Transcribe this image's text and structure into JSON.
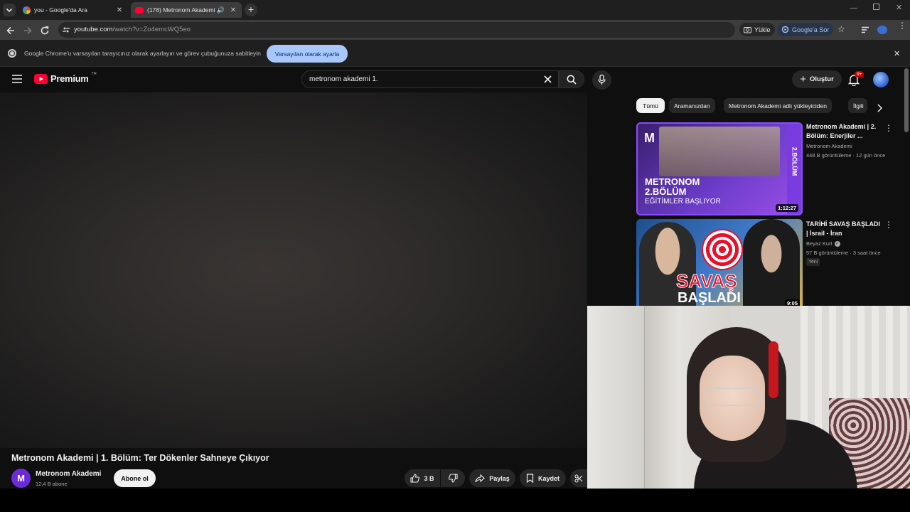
{
  "tabs": [
    {
      "title": "you - Google'da Ara",
      "active": false
    },
    {
      "title": "(178) Metronom Akademi |",
      "active": true
    }
  ],
  "omnibox": {
    "url_main": "youtube.com",
    "url_path": "/watch?v=Zo4emcWQ5eo"
  },
  "toolbar": {
    "upload_label": "Yükle",
    "ask_google_label": "Google'a Sor"
  },
  "infobar": {
    "message": "Google Chrome'u varsayılan tarayıcınız olarak ayarlayın ve görev çubuğunuza sabitleyin",
    "button_label": "Varsayılan olarak ayarla"
  },
  "youtube": {
    "logo_text": "Premium",
    "region": "TR",
    "search_value": "metronom akademi 1.",
    "create_label": "Oluştur",
    "notification_count": "9+"
  },
  "video": {
    "title": "Metronom Akademi | 1. Bölüm: Ter Dökenler Sahneye Çıkıyor",
    "channel_name": "Metronom Akademi",
    "channel_initial": "M",
    "subscribers": "12,4 B abone",
    "subscribe_label": "Abone ol",
    "likes": "3 B",
    "share_label": "Paylaş",
    "save_label": "Kaydet"
  },
  "chips": [
    {
      "label": "Tümü",
      "selected": true
    },
    {
      "label": "Aramanızdan",
      "selected": false
    },
    {
      "label": "Metronom Akademi adlı yükleyiciden",
      "selected": false
    },
    {
      "label": "İlgili",
      "selected": false
    }
  ],
  "recommendations": [
    {
      "title_line1": "Metronom Akademi | 2.",
      "title_line2": "Bölüm: Enerjiler ...",
      "channel": "Metronom Akademi",
      "meta": "448 B görüntüleme · 12 gün önce",
      "duration": "1:12:27",
      "thumb_line1": "METRONOM",
      "thumb_line2": "2.BÖLÜM",
      "thumb_line3": "EĞİTİMLER BAŞLIYOR",
      "thumb_side": "2.BÖLÜM"
    },
    {
      "title_line1": "TARİHİ SAVAŞ BAŞLADI",
      "title_line2": "| İsrail - İran",
      "channel": "Beyaz Kurt",
      "meta": "57 B görüntüleme · 3 saat önce",
      "badge": "Yeni",
      "duration": "9:05",
      "thumb_line1": "SAVAŞ",
      "thumb_line2": "BAŞLADI"
    }
  ],
  "colors": {
    "brand_red": "#ff0033",
    "accent_purple": "#6b2bd9",
    "infobar_button": "#a8c7fa"
  }
}
